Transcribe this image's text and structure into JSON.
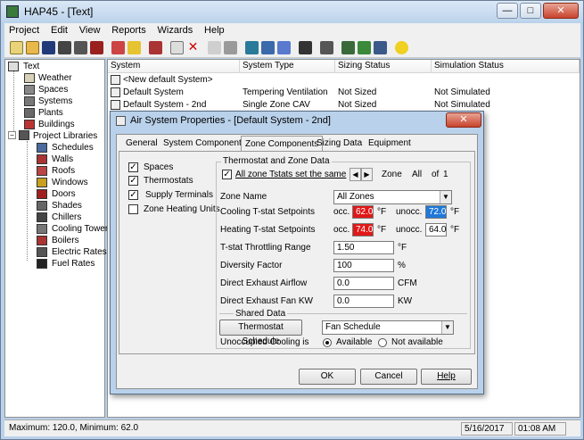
{
  "window": {
    "title": "HAP45 - [Text]",
    "min": "—",
    "max": "□",
    "close": "✕"
  },
  "menu": [
    "Project",
    "Edit",
    "View",
    "Reports",
    "Wizards",
    "Help"
  ],
  "tree": {
    "root": "Text",
    "items": [
      "Weather",
      "Spaces",
      "Systems",
      "Plants",
      "Buildings"
    ],
    "libraries_label": "Project Libraries",
    "libraries": [
      "Schedules",
      "Walls",
      "Roofs",
      "Windows",
      "Doors",
      "Shades",
      "Chillers",
      "Cooling Towers",
      "Boilers",
      "Electric Rates",
      "Fuel Rates"
    ]
  },
  "list": {
    "columns": [
      "System",
      "System Type",
      "Sizing Status",
      "Simulation Status"
    ],
    "rows": [
      {
        "system": "<New default System>",
        "type": "",
        "sizing": "",
        "sim": ""
      },
      {
        "system": "Default System",
        "type": "Tempering Ventilation",
        "sizing": "Not Sized",
        "sim": "Not Simulated"
      },
      {
        "system": "Default System - 2nd",
        "type": "Single Zone CAV",
        "sizing": "Not Sized",
        "sim": "Not Simulated"
      }
    ]
  },
  "statusbar": {
    "left": "Maximum: 120.0, Minimum: 62.0",
    "date": "5/16/2017",
    "time": "01:08 AM"
  },
  "dialog": {
    "title": "Air System Properties - [Default System - 2nd]",
    "close": "✕",
    "tabs": [
      "General",
      "System Components",
      "Zone Components",
      "Sizing Data",
      "Equipment"
    ],
    "components": [
      {
        "label": "Spaces",
        "checked": "✓"
      },
      {
        "label": "Thermostats",
        "checked": "✓"
      },
      {
        "label": "Supply Terminals",
        "checked": "✓"
      },
      {
        "label": "Zone Heating Units",
        "checked": ""
      }
    ],
    "tstat_group": "Thermostat and Zone Data",
    "all_zone_label": "All zone Tstats set the same",
    "all_zone_checked": "✓",
    "zone_label": "Zone",
    "zone_value": "All",
    "of_label": "of",
    "zone_total": "1",
    "zone_name_label": "Zone Name",
    "zone_name_value": "All Zones",
    "cooling_label": "Cooling T-stat Setpoints",
    "heating_label": "Heating T-stat Setpoints",
    "occ_label": "occ.",
    "unocc_label": "unocc.",
    "deg_unit": "°F",
    "cooling_occ": "62.0",
    "cooling_unocc": "72.0",
    "heating_occ": "74.0",
    "heating_unocc": "64.0",
    "throttling_label": "T-stat Throttling Range",
    "throttling_value": "1.50",
    "diversity_label": "Diversity Factor",
    "diversity_value": "100",
    "diversity_unit": "%",
    "exhaust_airflow_label": "Direct Exhaust Airflow",
    "exhaust_airflow_value": "0.0",
    "exhaust_airflow_unit": "CFM",
    "exhaust_fan_label": "Direct Exhaust Fan KW",
    "exhaust_fan_value": "0.0",
    "exhaust_fan_unit": "KW",
    "shared_label": "Shared Data",
    "tstat_schedule_btn": "Thermostat Schedule",
    "fan_schedule_value": "Fan Schedule",
    "unocc_cooling_label": "Unoccupied Cooling is",
    "available_label": "Available",
    "not_available_label": "Not available",
    "ok": "OK",
    "cancel": "Cancel",
    "help": "Help"
  },
  "colors": {
    "red_field": "#e01818",
    "blue_field": "#1f79d8",
    "window_frame": "#b9d1ea"
  }
}
